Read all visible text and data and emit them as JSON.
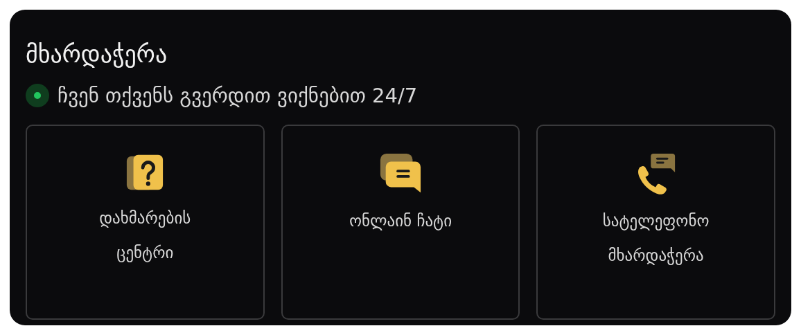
{
  "title": "მხარდაჭერა",
  "status": {
    "online": true,
    "text": "ჩვენ თქვენს გვერდით ვიქნებით 24/7"
  },
  "options": [
    {
      "kind": "help",
      "label": "დახმარების ცენტრი"
    },
    {
      "kind": "chat",
      "label": "ონლაინ ჩატი"
    },
    {
      "kind": "phone",
      "label": "სატელეფონო მხარდაჭერა"
    }
  ]
}
